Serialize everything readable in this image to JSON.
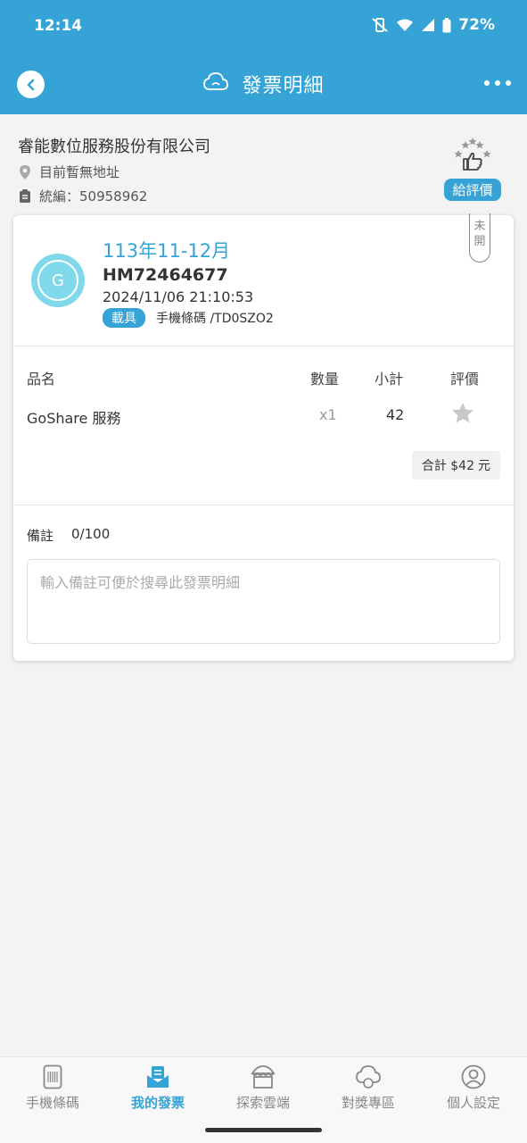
{
  "status_bar": {
    "time": "12:14",
    "battery": "72%"
  },
  "header": {
    "title": "發票明細"
  },
  "seller": {
    "name": "睿能數位服務股份有限公司",
    "address": "目前暫無地址",
    "tax_id": "統編：50958962",
    "rate_label": "給評價"
  },
  "invoice": {
    "status_tag_top": "未",
    "status_tag_bottom": "開",
    "avatar_letter": "G",
    "period": "113年11-12月",
    "number": "HM72464677",
    "datetime": "2024/11/06 21:10:53",
    "carrier_badge": "載具",
    "carrier": "手機條碼 /TD0SZO2"
  },
  "items_table": {
    "headers": {
      "name": "品名",
      "qty": "數量",
      "subtotal": "小計",
      "rating": "評價"
    },
    "rows": [
      {
        "name": "GoShare 服務",
        "qty": "x1",
        "subtotal": "42"
      }
    ],
    "total_label": "合計 $42",
    "total_unit": "元"
  },
  "memo": {
    "label": "備註",
    "count": "0/100",
    "value": "",
    "placeholder": "輸入備註可便於搜尋此發票明細"
  },
  "bottom_nav": {
    "items": [
      {
        "label": "手機條碼",
        "icon": "phone-barcode-icon"
      },
      {
        "label": "我的發票",
        "icon": "invoice-icon",
        "active": true
      },
      {
        "label": "探索雲端",
        "icon": "store-icon"
      },
      {
        "label": "對獎專區",
        "icon": "cloud-prize-icon"
      },
      {
        "label": "個人設定",
        "icon": "person-icon"
      }
    ]
  },
  "colors": {
    "primary": "#35a3d6",
    "avatar": "#7fd9ea",
    "background": "#f3f3f3"
  }
}
